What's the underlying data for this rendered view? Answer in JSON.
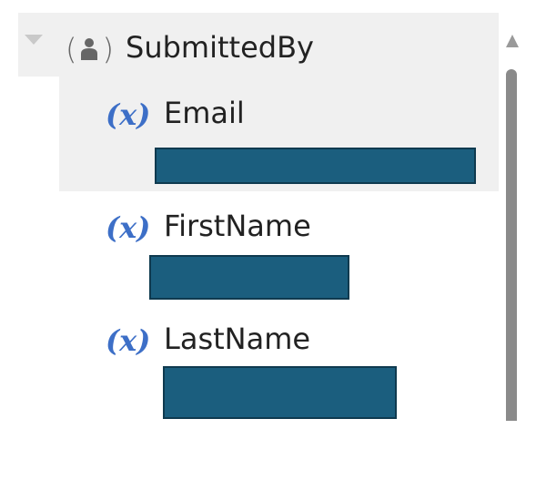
{
  "tree": {
    "parent": {
      "label": "SubmittedBy",
      "icon": "person-object-icon",
      "expanded": true
    },
    "fields": [
      {
        "label": "Email",
        "icon_text": "(x)",
        "icon": "variable-icon",
        "value": "",
        "value_redacted": true
      },
      {
        "label": "FirstName",
        "icon_text": "(x)",
        "icon": "variable-icon",
        "value": "",
        "value_redacted": true
      },
      {
        "label": "LastName",
        "icon_text": "(x)",
        "icon": "variable-icon",
        "value": "",
        "value_redacted": true
      }
    ]
  },
  "colors": {
    "variable_icon": "#3d6fc7",
    "redaction": "#1b5e7e",
    "row_highlight": "#f0f0f0",
    "scrollbar": "#8a8a8a"
  }
}
